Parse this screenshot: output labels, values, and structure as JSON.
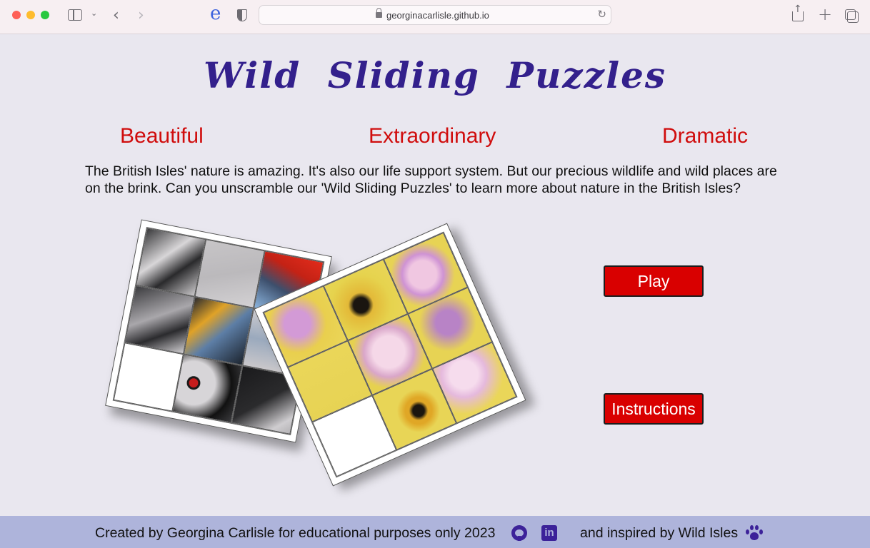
{
  "browser": {
    "url": "georginacarlisle.github.io"
  },
  "page": {
    "title": "Wild Sliding Puzzles",
    "taglines": [
      "Beautiful",
      "Extraordinary",
      "Dramatic"
    ],
    "intro": "The British Isles' nature is amazing. It's also our life support system. But our precious wildlife and wild places are on the brink. Can you unscramble our 'Wild Sliding Puzzles' to learn more about nature in the British Isles?",
    "buttons": {
      "play": "Play",
      "instructions": "Instructions"
    },
    "accent_color": "#d90000",
    "title_color": "#33208c"
  },
  "footer": {
    "credit": "Created by Georgina Carlisle for educational purposes only 2023",
    "inspired": "and inspired by Wild Isles",
    "icons": [
      "github-icon",
      "linkedin-icon",
      "paw-icon"
    ],
    "background": "#aeb4db"
  }
}
